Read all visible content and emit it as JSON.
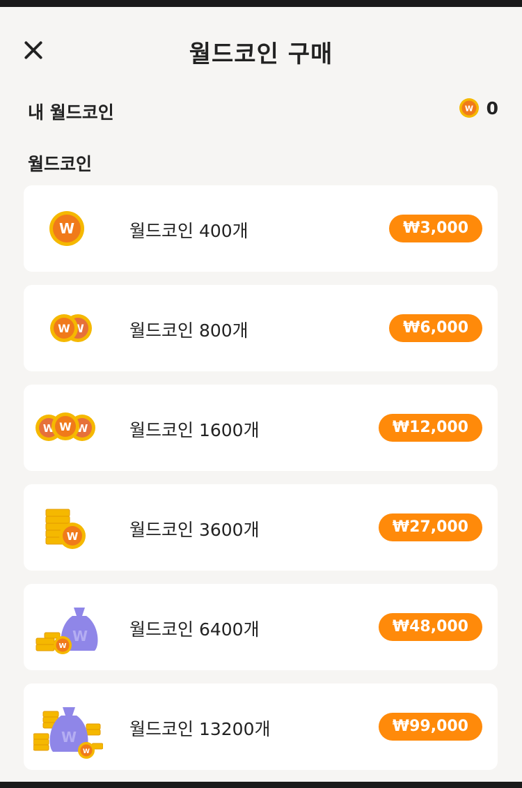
{
  "header": {
    "title": "월드코인 구매",
    "close_icon": "close-icon"
  },
  "balance": {
    "label": "내 월드코인",
    "count": "0",
    "coin_symbol": "W"
  },
  "section": {
    "title": "월드코인"
  },
  "coin_symbol": "W",
  "colors": {
    "accent": "#ff8a0a",
    "coin_outer": "#f5b800",
    "coin_inner": "#f07a1a",
    "bag": "#8f86e8",
    "background": "#f6f5f3"
  },
  "products": [
    {
      "label": "월드코인 400개",
      "price": "₩3,000",
      "icon": "single-coin-icon"
    },
    {
      "label": "월드코인 800개",
      "price": "₩6,000",
      "icon": "two-coins-icon"
    },
    {
      "label": "월드코인 1600개",
      "price": "₩12,000",
      "icon": "three-coins-icon"
    },
    {
      "label": "월드코인 3600개",
      "price": "₩27,000",
      "icon": "coin-stack-icon"
    },
    {
      "label": "월드코인 6400개",
      "price": "₩48,000",
      "icon": "coin-bag-icon"
    },
    {
      "label": "월드코인 13200개",
      "price": "₩99,000",
      "icon": "coin-bag-stack-icon"
    }
  ]
}
